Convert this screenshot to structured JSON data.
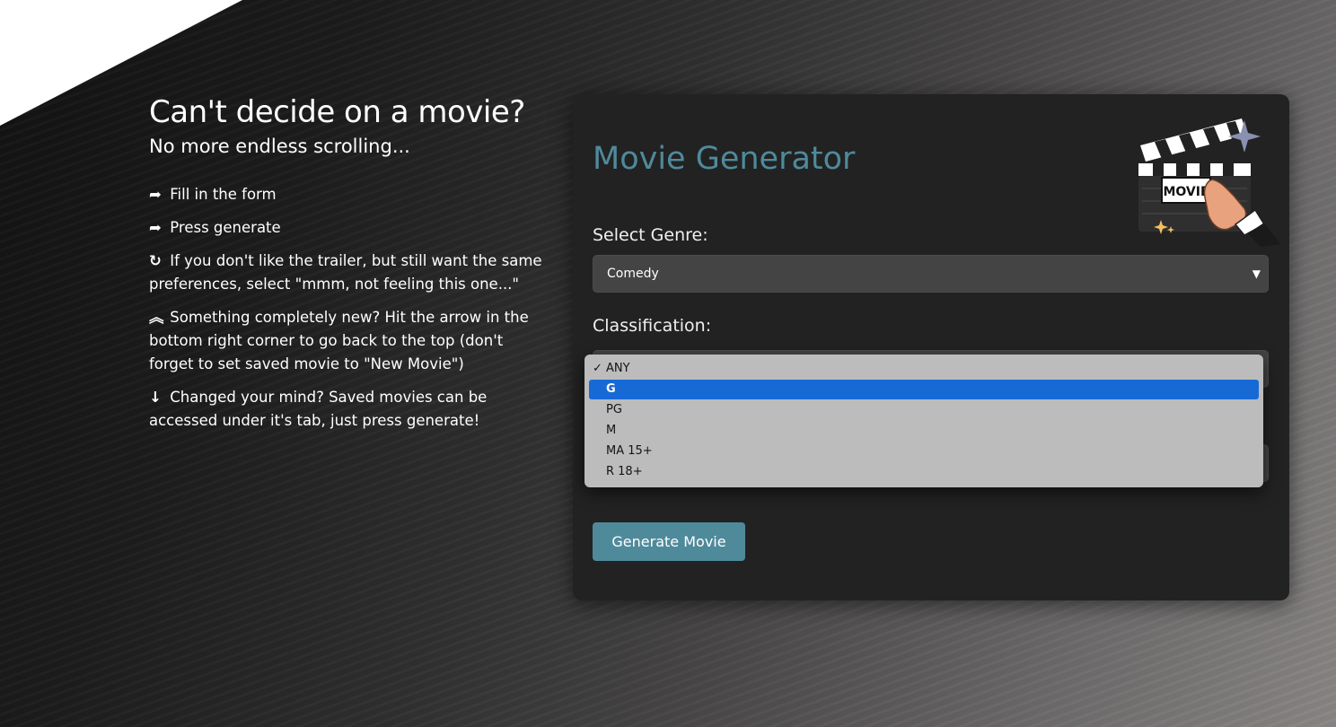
{
  "intro": {
    "title": "Can't decide on a movie?",
    "subtitle": "No more endless scrolling...",
    "steps": [
      {
        "icon": "share-arrow-icon",
        "glyph": "➦",
        "text": "Fill in the form"
      },
      {
        "icon": "share-arrow-icon",
        "glyph": "➦",
        "text": "Press generate"
      },
      {
        "icon": "redo-icon",
        "glyph": "↻",
        "text": "If you don't like the trailer, but still want the same preferences, select \"mmm, not feeling this one...\""
      },
      {
        "icon": "double-chevron-up-icon",
        "glyph": "︽",
        "text": "Something completely new? Hit the arrow in the bottom right corner to go back to the top (don't forget to set saved movie to \"New Movie\")"
      },
      {
        "icon": "arrow-down-icon",
        "glyph": "↓",
        "text": "Changed your mind? Saved movies can be accessed under it's tab, just press generate!"
      }
    ]
  },
  "form": {
    "title": "Movie Generator",
    "genre_label": "Select Genre:",
    "genre_value": "Comedy",
    "classification_label": "Classification:",
    "classification_options": [
      "ANY",
      "G",
      "PG",
      "M",
      "MA 15+",
      "R 18+"
    ],
    "checked_option": "ANY",
    "highlighted_option": "G",
    "generate_label": "Generate Movie",
    "clapper_text": "MOVIE"
  },
  "colors": {
    "accent": "#4f8a9b",
    "card": "#222222",
    "select": "#444444",
    "highlight": "#1769d6"
  }
}
